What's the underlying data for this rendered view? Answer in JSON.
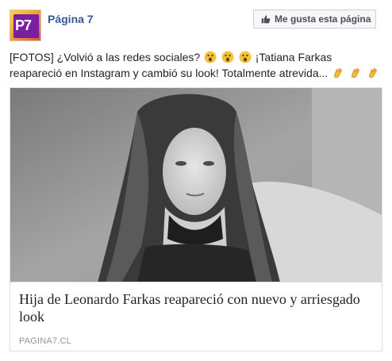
{
  "header": {
    "page_name": "Página 7",
    "logo_text": "P7",
    "like_button_label": "Me gusta esta página"
  },
  "post": {
    "text_part1": "[FOTOS] ¿Volvió a las redes sociales?",
    "text_part2": "¡Tatiana Farkas reapareció en Instagram y cambió su look! Totalmente atrevida...",
    "emojis_after_question": [
      "astonished-face",
      "astonished-face",
      "astonished-face"
    ],
    "emojis_end": [
      "clapping-hands",
      "clapping-hands",
      "clapping-hands"
    ]
  },
  "link_card": {
    "image": "black-and-white-portrait-photo",
    "title": "Hija de Leonardo Farkas reapareció con nuevo y arriesgado look",
    "domain": "PAGINA7.CL"
  },
  "colors": {
    "page_name": "#365899",
    "text": "#1d2129",
    "domain": "#90949c",
    "border": "#dddfe2"
  }
}
